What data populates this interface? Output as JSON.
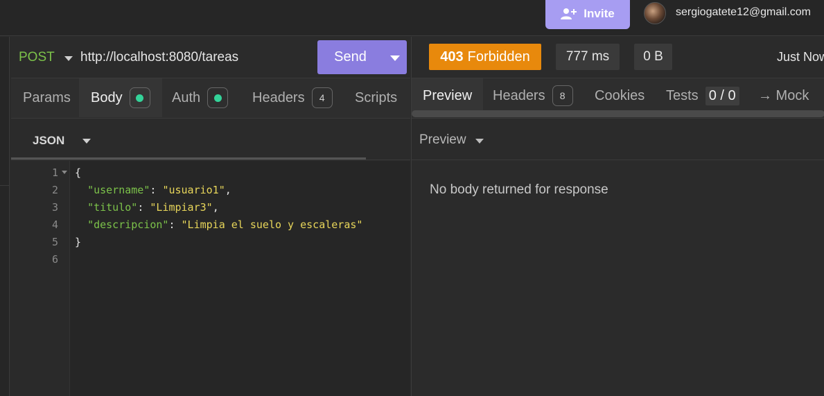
{
  "header": {
    "invite_label": "Invite",
    "user_email": "sergiogatete12@gmail.com"
  },
  "request": {
    "method": "POST",
    "url": "http://localhost:8080/tareas",
    "send_label": "Send",
    "tabs": [
      {
        "label": "Params"
      },
      {
        "label": "Body",
        "active": true,
        "indicator": "green-dot"
      },
      {
        "label": "Auth",
        "indicator": "green-dot"
      },
      {
        "label": "Headers",
        "count": "4"
      },
      {
        "label": "Scripts"
      }
    ],
    "body_type": "JSON",
    "body_lines": [
      {
        "n": "1",
        "text": "{"
      },
      {
        "n": "2",
        "key": "\"username\"",
        "value": "\"usuario1\""
      },
      {
        "n": "3",
        "key": "\"titulo\"",
        "value": "\"Limpiar3\""
      },
      {
        "n": "4",
        "key": "\"descripcion\"",
        "value": "\"Limpia el suelo y escaleras\""
      },
      {
        "n": "5",
        "text": "}"
      },
      {
        "n": "6",
        "text": ""
      }
    ]
  },
  "response": {
    "status_code": "403",
    "status_text": "Forbidden",
    "time": "777 ms",
    "size": "0 B",
    "timestamp": "Just Now",
    "tabs": [
      {
        "label": "Preview",
        "active": true
      },
      {
        "label": "Headers",
        "count": "8"
      },
      {
        "label": "Cookies"
      },
      {
        "label": "Tests",
        "count": "0 / 0"
      },
      {
        "label": "→ Mock"
      }
    ],
    "preview_mode": "Preview",
    "empty_message": "No body returned for response"
  },
  "colors": {
    "send_button": "#8a7ddf",
    "invite_button": "#a79df2",
    "status_forbidden": "#e8890c",
    "method_post": "#7cc24a",
    "json_key": "#7cc24a",
    "json_string": "#e8d65a",
    "indicator_dot": "#34d399"
  }
}
